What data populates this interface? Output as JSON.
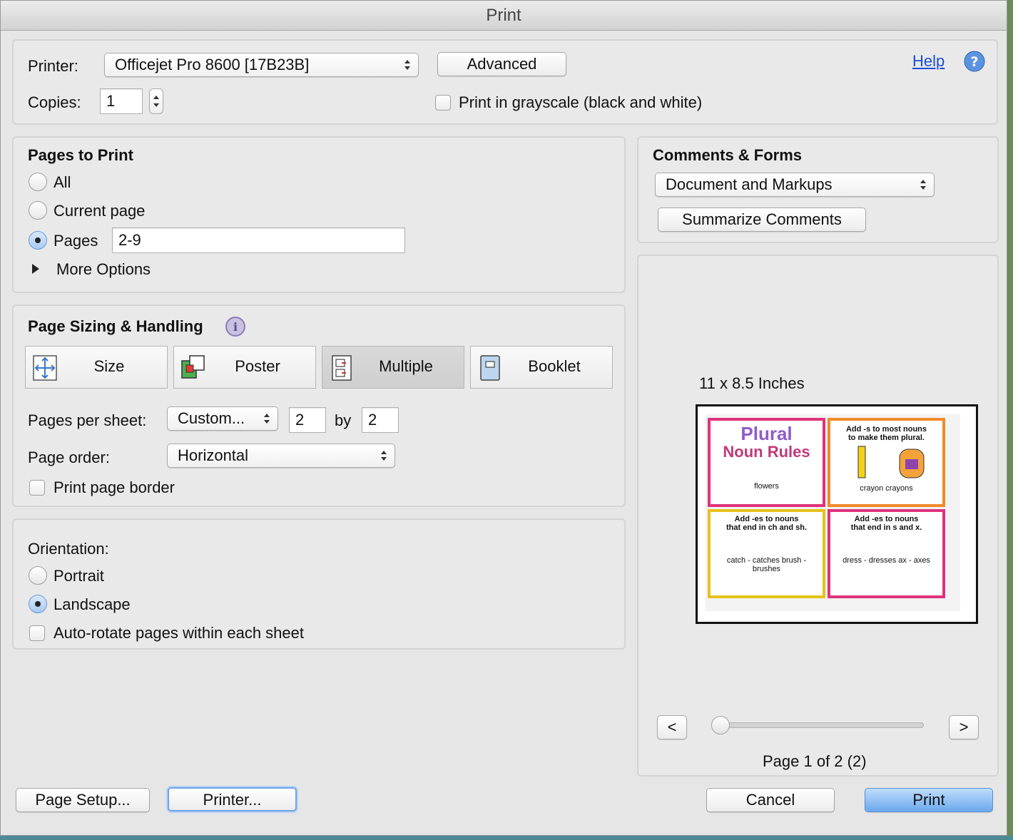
{
  "window": {
    "title": "Print"
  },
  "printer": {
    "label": "Printer:",
    "selected": "Officejet Pro 8600 [17B23B]",
    "advanced_label": "Advanced",
    "help_label": "Help"
  },
  "copies": {
    "label": "Copies:",
    "value": "1",
    "grayscale_label": "Print in grayscale (black and white)",
    "grayscale_checked": false
  },
  "pages_to_print": {
    "heading": "Pages to Print",
    "options": [
      "All",
      "Current page",
      "Pages"
    ],
    "selected": "Pages",
    "pages_value": "2-9",
    "more_options_label": "More Options"
  },
  "comments_forms": {
    "heading": "Comments & Forms",
    "selected": "Document and Markups",
    "summarize_label": "Summarize Comments"
  },
  "page_sizing": {
    "heading": "Page Sizing & Handling",
    "modes": [
      "Size",
      "Poster",
      "Multiple",
      "Booklet"
    ],
    "active_mode": "Multiple",
    "pages_per_sheet_label": "Pages per sheet:",
    "pages_per_sheet_value": "Custom...",
    "cols": "2",
    "by_label": "by",
    "rows": "2",
    "page_order_label": "Page order:",
    "page_order_value": "Horizontal",
    "border_label": "Print page border"
  },
  "orientation": {
    "label": "Orientation:",
    "options": [
      "Portrait",
      "Landscape"
    ],
    "selected": "Landscape",
    "autorotate_label": "Auto-rotate pages within each sheet"
  },
  "preview": {
    "size_label": "11 x 8.5 Inches",
    "prev_label": "<",
    "next_label": ">",
    "page_status": "Page 1 of 2 (2)",
    "thumbs": [
      {
        "title1": "Plural",
        "title2": "Noun Rules",
        "caption": "flowers",
        "color": "#e0327a"
      },
      {
        "title1": "Add -s to most nouns",
        "title2": "to make them plural.",
        "caption": "crayon    crayons",
        "color": "#f08a2a"
      },
      {
        "title1": "Add -es to nouns",
        "title2": "that end in ch and sh.",
        "caption": "catch - catches   brush - brushes",
        "color": "#e6c21c"
      },
      {
        "title1": "Add -es to nouns",
        "title2": "that end in s and x.",
        "caption": "dress - dresses   ax - axes",
        "color": "#e0327a"
      }
    ]
  },
  "footer": {
    "page_setup_label": "Page Setup...",
    "printer_label": "Printer...",
    "cancel_label": "Cancel",
    "print_label": "Print"
  },
  "colors": {
    "accent": "#6aa9ef",
    "link": "#1a4fd6"
  }
}
